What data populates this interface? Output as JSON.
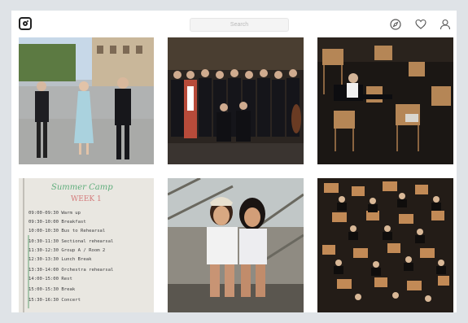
{
  "search": {
    "placeholder": "Search"
  },
  "photo_note": {
    "heading": "Summer Camp",
    "subheading": "WEEK 1",
    "lines": [
      "09:00-09:30 Warm up",
      "09:30-10:00 Breakfast",
      "10:00-10:30 Bus to Rehearsal",
      "10:30-11:30 Sectional rehearsal",
      "11:30-12:30 Group A / Room 2",
      "12:30-13:30 Lunch Break",
      "13:30-14:00 Orchestra rehearsal",
      "14:00-15:00 Rest",
      "15:00-15:30 Break",
      "15:30-16:30 Concert"
    ]
  },
  "colors": {
    "background": "#dfe3e7",
    "window": "#ffffff",
    "icon": "#555555"
  }
}
